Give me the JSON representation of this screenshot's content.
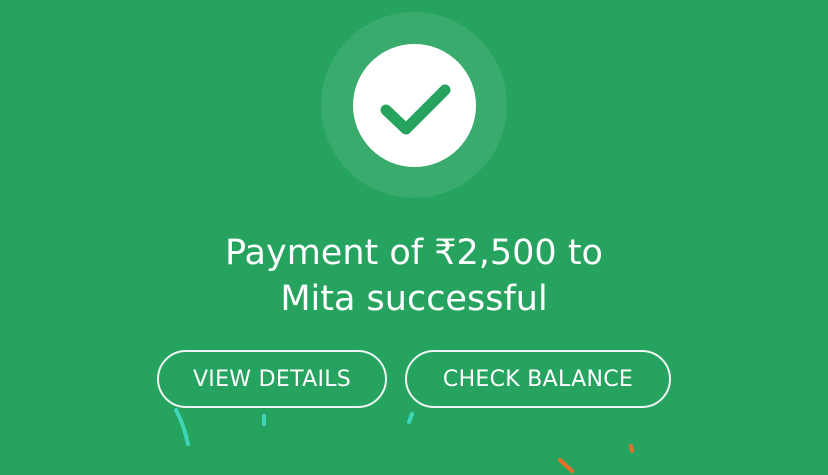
{
  "status": {
    "icon": "check-icon",
    "message_line1": "Payment of ₹2,500 to",
    "message_line2": "Mita successful"
  },
  "actions": {
    "view_details_label": "VIEW DETAILS",
    "check_balance_label": "CHECK BALANCE"
  },
  "colors": {
    "background": "#25a35f",
    "check": "#25a35f",
    "confetti_teal": "#3fd6b8",
    "confetti_orange": "#e8702a"
  }
}
